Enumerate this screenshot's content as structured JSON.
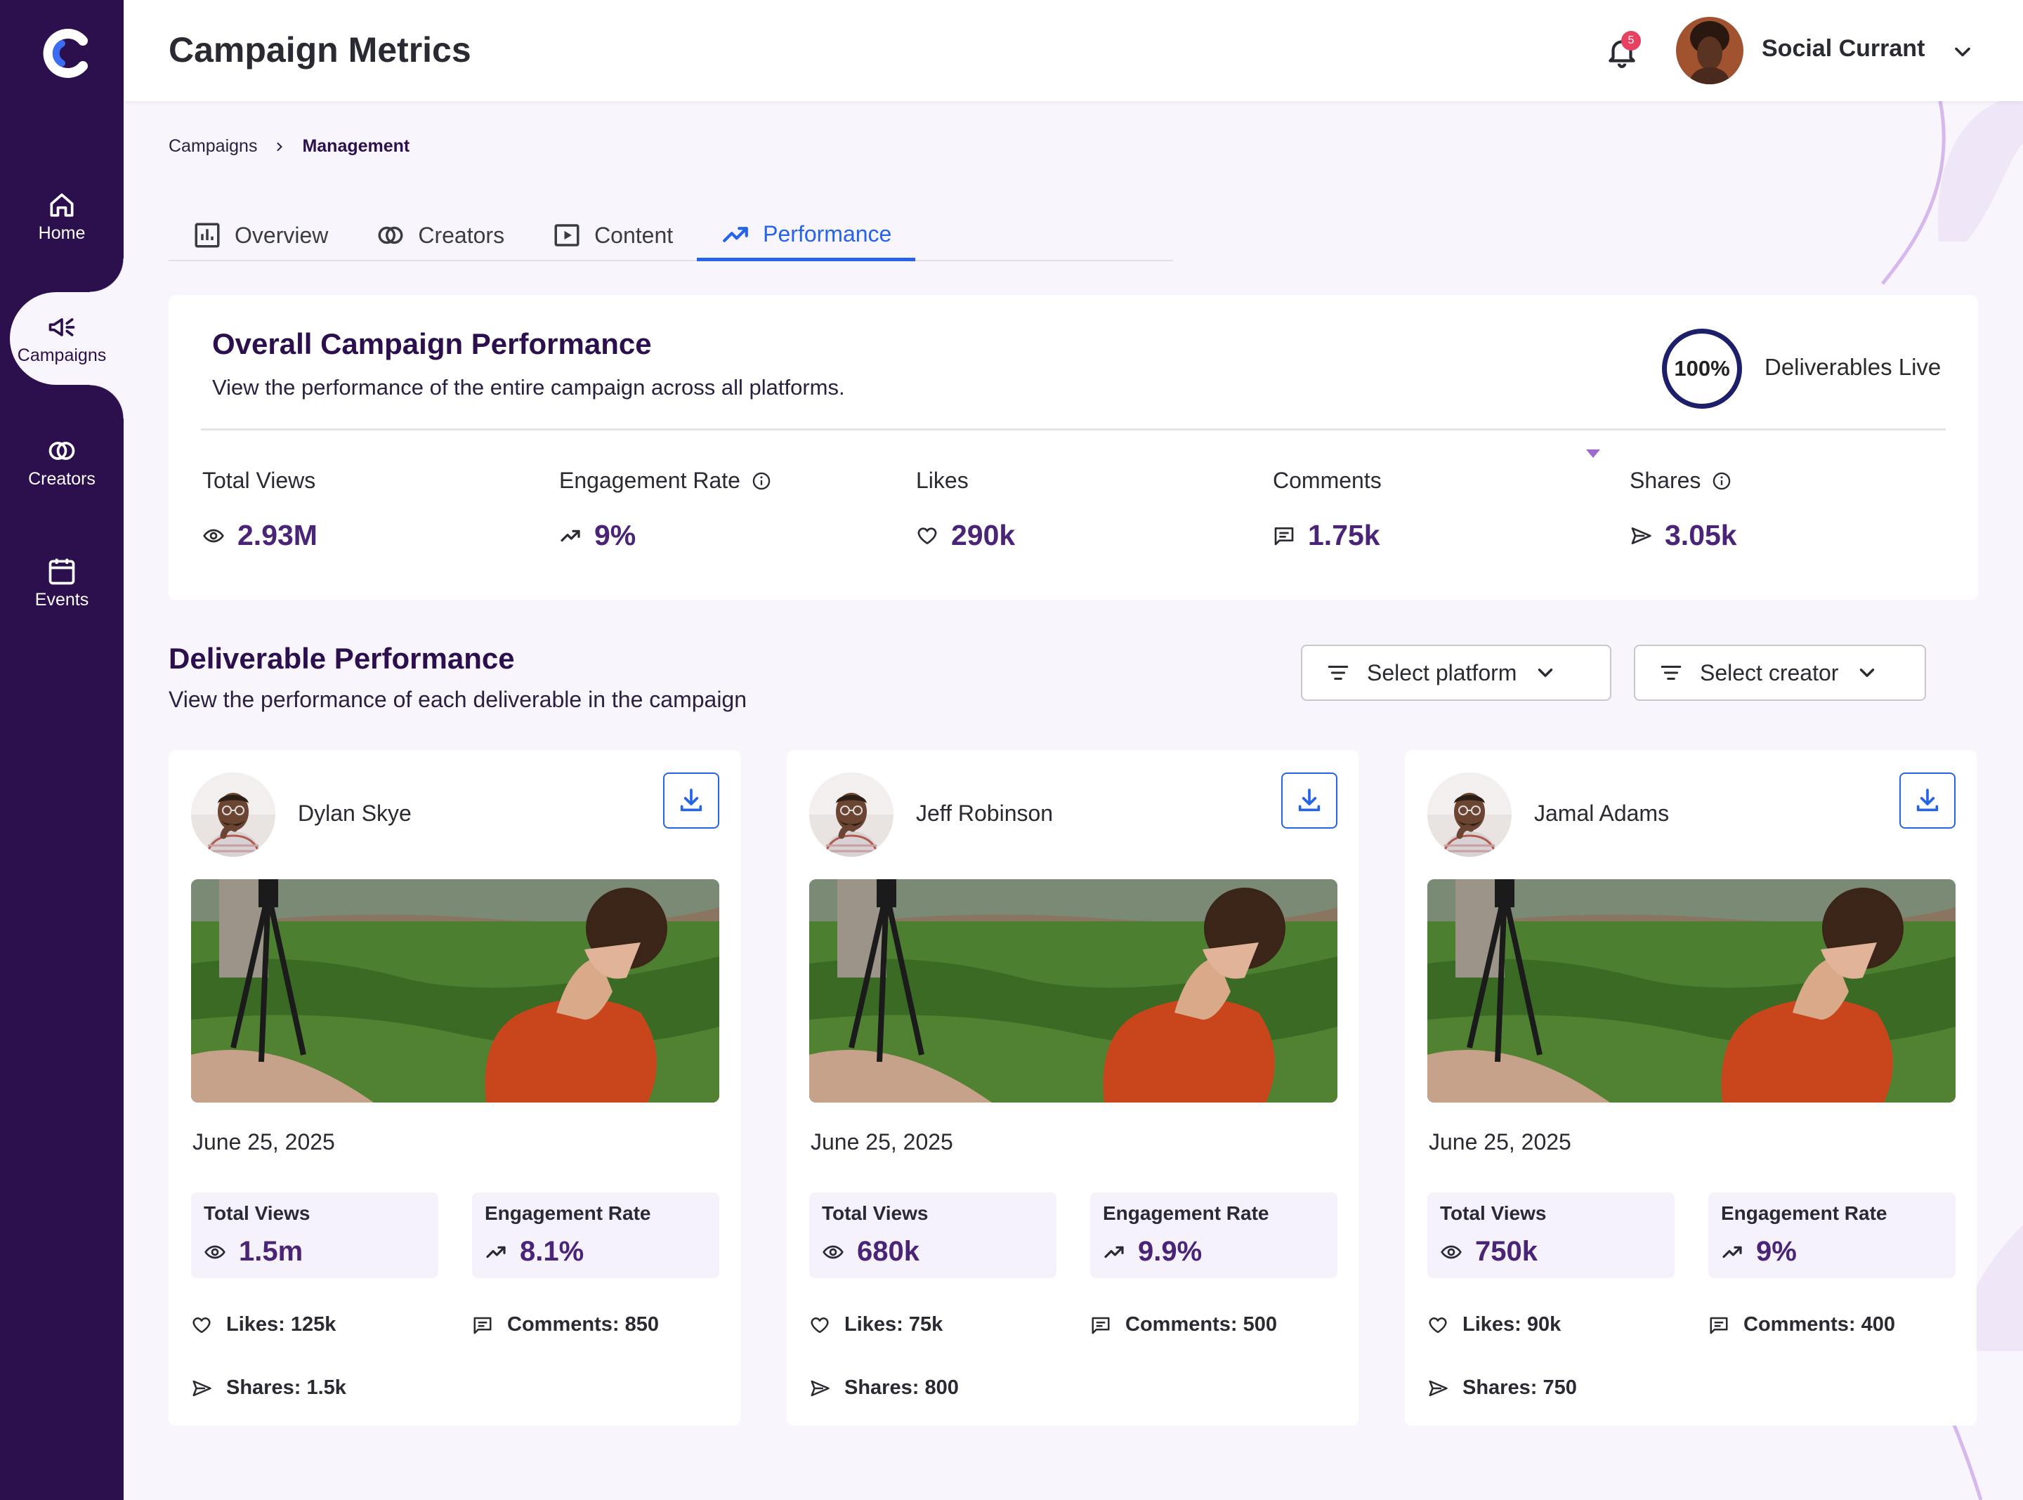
{
  "header": {
    "title": "Campaign Metrics",
    "notification_count": "5",
    "user_name": "Social Currant"
  },
  "sidebar": {
    "items": [
      {
        "label": "Home",
        "icon": "home-icon"
      },
      {
        "label": "Campaigns",
        "icon": "megaphone-icon"
      },
      {
        "label": "Creators",
        "icon": "creators-icon"
      },
      {
        "label": "Events",
        "icon": "calendar-icon"
      }
    ]
  },
  "breadcrumb": {
    "parent": "Campaigns",
    "current": "Management"
  },
  "tabs": [
    {
      "label": "Overview",
      "icon": "bar-chart-icon"
    },
    {
      "label": "Creators",
      "icon": "creators-icon"
    },
    {
      "label": "Content",
      "icon": "play-icon"
    },
    {
      "label": "Performance",
      "icon": "trending-up-icon"
    }
  ],
  "overall": {
    "title": "Overall Campaign Performance",
    "subtitle": "View the performance of the entire campaign across all platforms.",
    "deliverables_percent": "100%",
    "deliverables_label": "Deliverables Live",
    "metrics": [
      {
        "label": "Total Views",
        "value": "2.93M",
        "icon": "eye-icon"
      },
      {
        "label": "Engagement Rate",
        "value": "9%",
        "icon": "trending-up-icon",
        "info": true
      },
      {
        "label": "Likes",
        "value": "290k",
        "icon": "heart-icon"
      },
      {
        "label": "Comments",
        "value": "1.75k",
        "icon": "comment-icon"
      },
      {
        "label": "Shares",
        "value": "3.05k",
        "icon": "send-icon",
        "info": true
      }
    ]
  },
  "deliverables": {
    "title": "Deliverable Performance",
    "subtitle": "View the performance of each deliverable in the campaign",
    "platform_select": "Select platform",
    "creator_select": "Select creator",
    "cards": [
      {
        "name": "Dylan Skye",
        "date": "June 25, 2025",
        "views_label": "Total Views",
        "views": "1.5m",
        "engagement_label": "Engagement Rate",
        "engagement": "8.1%",
        "likes": "Likes: 125k",
        "comments": "Comments: 850",
        "shares": "Shares: 1.5k"
      },
      {
        "name": "Jeff Robinson",
        "date": "June 25, 2025",
        "views_label": "Total Views",
        "views": "680k",
        "engagement_label": "Engagement Rate",
        "engagement": "9.9%",
        "likes": "Likes: 75k",
        "comments": "Comments: 500",
        "shares": "Shares: 800"
      },
      {
        "name": "Jamal Adams",
        "date": "June 25, 2025",
        "views_label": "Total Views",
        "views": "750k",
        "engagement_label": "Engagement Rate",
        "engagement": "9%",
        "likes": "Likes: 90k",
        "comments": "Comments: 400",
        "shares": "Shares: 750"
      }
    ]
  },
  "colors": {
    "sidebar": "#2c0f4d",
    "accent": "#2563eb",
    "heading": "#2c0f4d",
    "value": "#4a2577",
    "badge": "#e84060"
  }
}
